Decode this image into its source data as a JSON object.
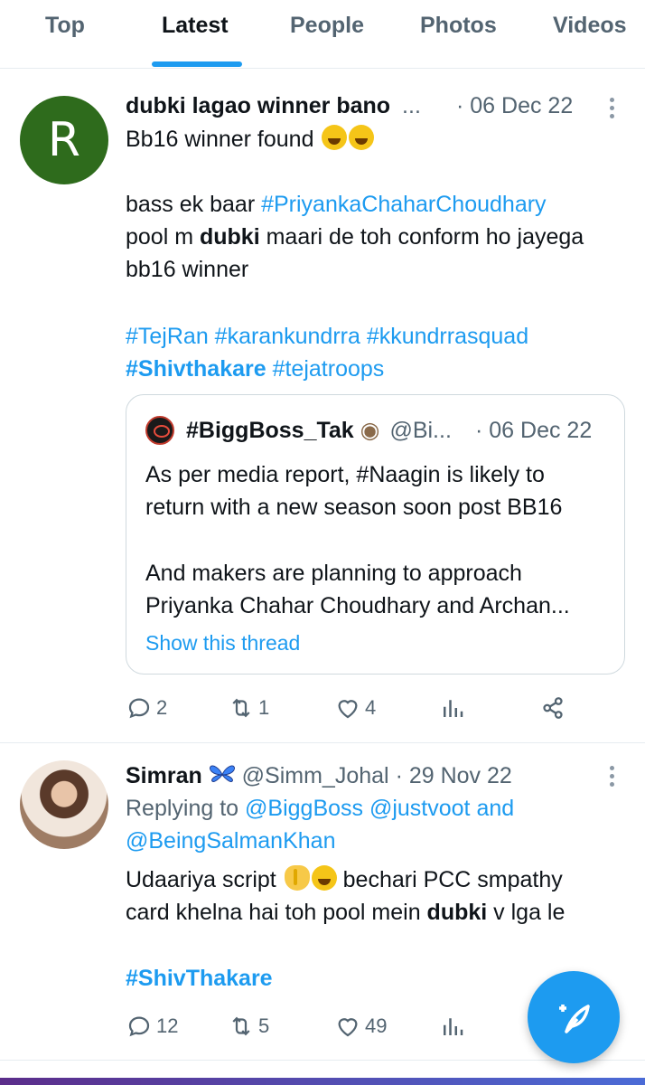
{
  "tabs": [
    "Top",
    "Latest",
    "People",
    "Photos",
    "Videos"
  ],
  "active_tab": "Latest",
  "tweet1": {
    "avatar_letter": "R",
    "name": "dubki lagao winner bano",
    "name_more": "...",
    "date": "· 06 Dec 22",
    "text_line1": "Bb16 winner found",
    "text_bass": "bass ek baar ",
    "hashtag_pcc": "#PriyankaChaharChoudhary",
    "text_pool_prefix": "pool m ",
    "text_pool_bold": "dubki",
    "text_pool_suffix": " maari de toh conform ho jayega",
    "text_bb16": "bb16 winner",
    "hashtags_line": "#TejRan #karankundrra #kkundrrasquad",
    "hashtag_shiv": "#Shivthakare",
    "hashtag_teja": " #tejatroops",
    "quote": {
      "name": "#BiggBoss_Tak",
      "handle": "@Bi...",
      "date": "· 06 Dec 22",
      "line1": "As per media report, #Naagin is likely to",
      "line2": "return with a new season soon post BB16",
      "line3": "And makers are planning to approach",
      "line4": "Priyanka Chahar Choudhary and Archan...",
      "show_thread": "Show this thread"
    },
    "replies": "2",
    "retweets": "1",
    "likes": "4"
  },
  "tweet2": {
    "name": "Simran",
    "handle": "@Simm_Johal",
    "date": "· 29 Nov 22",
    "replying_to": "Replying to ",
    "mention1": "@BiggBoss @justvoot and",
    "mention2": "@BeingSalmanKhan",
    "text_line1": "Udaariya script",
    "text_line1_suffix": " bechari PCC smpathy",
    "text_line2_prefix": "card khelna hai toh pool mein ",
    "text_line2_bold": "dubki",
    "text_line2_suffix": " v lga le",
    "hashtag": "#ShivThakare",
    "replies": "12",
    "retweets": "5",
    "likes": "49"
  },
  "colors": {
    "accent": "#1d9bf0",
    "muted": "#536471",
    "text": "#0f1419"
  },
  "icons": [
    "reply-icon",
    "retweet-icon",
    "like-icon",
    "analytics-icon",
    "share-icon",
    "more-icon",
    "compose-icon"
  ]
}
